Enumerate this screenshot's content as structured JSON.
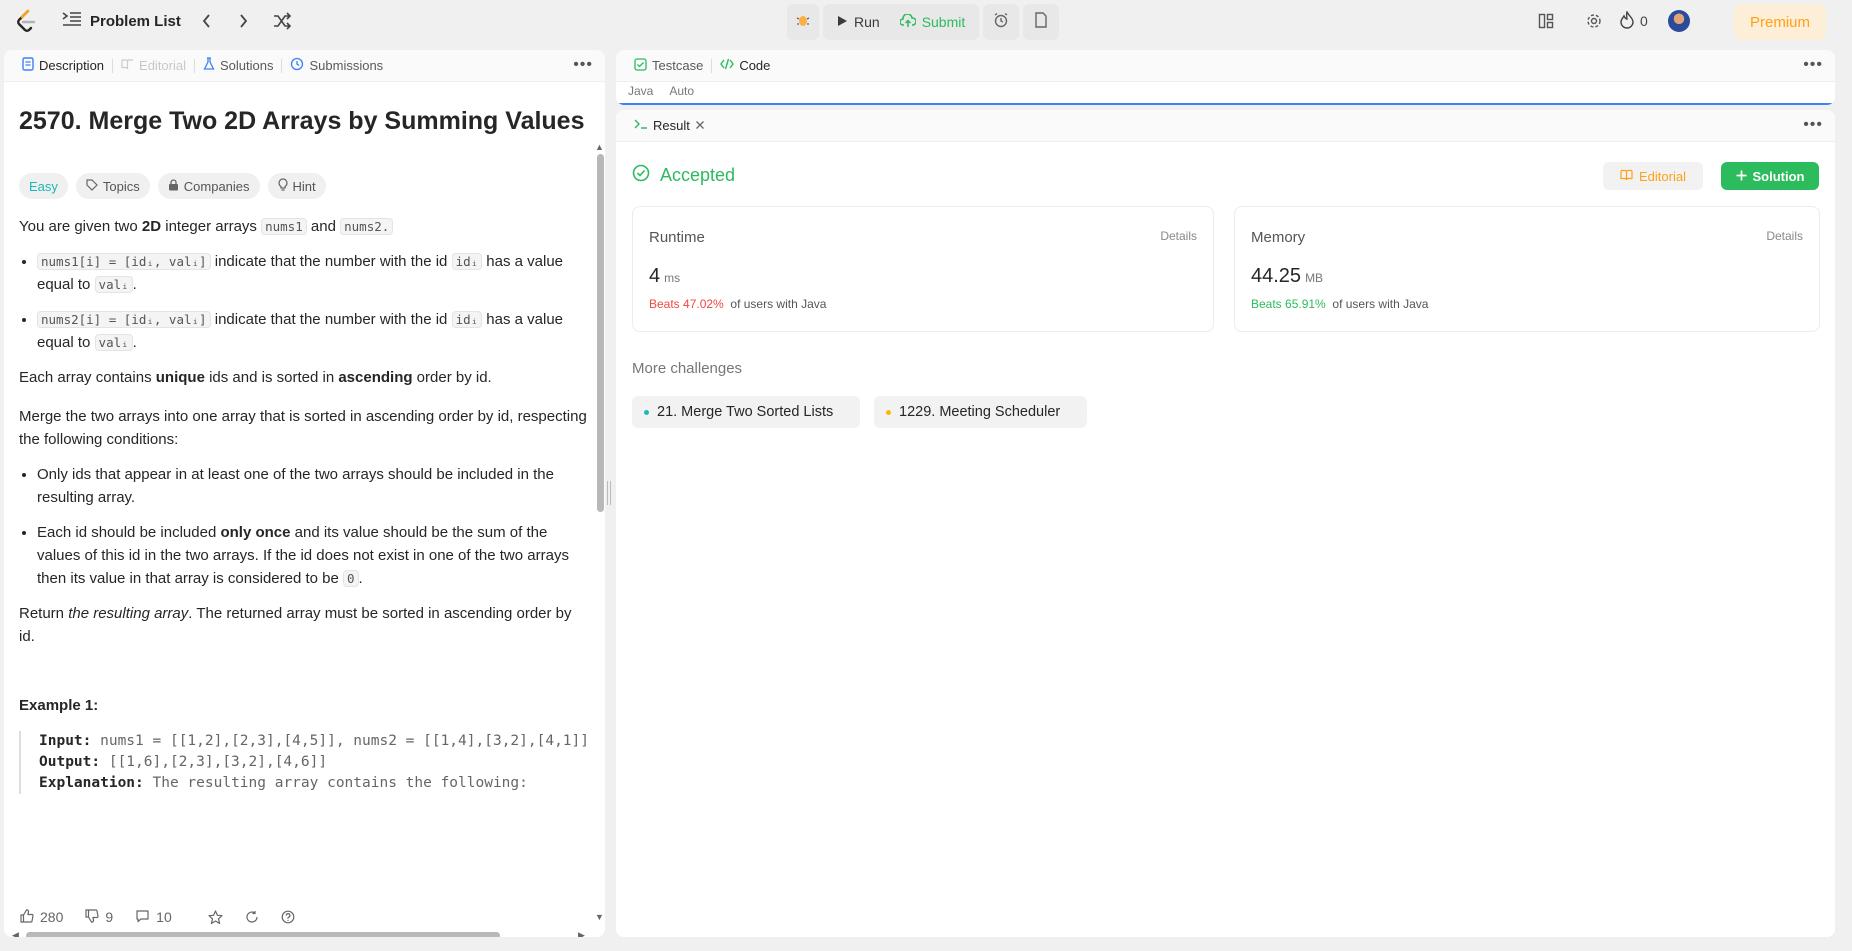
{
  "topbar": {
    "problem_list": "Problem List",
    "run_label": "Run",
    "submit_label": "Submit",
    "streak_count": "0",
    "premium_label": "Premium"
  },
  "left_tabs": {
    "description": "Description",
    "editorial": "Editorial",
    "solutions": "Solutions",
    "submissions": "Submissions"
  },
  "problem": {
    "title": "2570. Merge Two 2D Arrays by Summing Values",
    "difficulty": "Easy",
    "chips": [
      "Topics",
      "Companies",
      "Hint"
    ],
    "intro_pre": "You are given two ",
    "intro_bold": "2D",
    "intro_mid": " integer arrays ",
    "intro_code1": "nums1",
    "intro_and": " and ",
    "intro_code2": "nums2.",
    "bullet1_code": "nums1[i] = [idᵢ, valᵢ]",
    "bullet1_text": " indicate that the number with the id ",
    "bullet1_code2": "idᵢ",
    "bullet1_tail": " has a value equal to ",
    "bullet1_code3": "valᵢ",
    "bullet2_code": "nums2[i] = [idᵢ, valᵢ]",
    "bullet2_text": " indicate that the number with the id ",
    "bullet2_code2": "idᵢ",
    "bullet2_tail": " has a value equal to ",
    "bullet2_code3": "valᵢ",
    "para2_pre": "Each array contains ",
    "para2_bold1": "unique",
    "para2_mid": " ids and is sorted in ",
    "para2_bold2": "ascending",
    "para2_tail": " order by id.",
    "para3": "Merge the two arrays into one array that is sorted in ascending order by id, respecting the following conditions:",
    "cond1": "Only ids that appear in at least one of the two arrays should be included in the resulting array.",
    "cond2_pre": "Each id should be included ",
    "cond2_bold": "only once",
    "cond2_tail": " and its value should be the sum of the values of this id in the two arrays. If the id does not exist in one of the two arrays then its value in that array is considered to be ",
    "cond2_code": "0",
    "para4_pre": "Return ",
    "para4_em": "the resulting array",
    "para4_tail": ". The returned array must be sorted in ascending order by id.",
    "example_title": "Example 1:",
    "ex_input_label": "Input:",
    "ex_input": " nums1 = [[1,2],[2,3],[4,5]], nums2 = [[1,4],[3,2],[4,1]]",
    "ex_output_label": "Output:",
    "ex_output": " [[1,6],[2,3],[3,2],[4,6]]",
    "ex_expl_label": "Explanation:",
    "ex_expl": " The resulting array contains the following:"
  },
  "footer": {
    "likes": "280",
    "dislikes": "9",
    "comments": "10"
  },
  "right_tabs": {
    "testcase": "Testcase",
    "code": "Code",
    "language": "Java",
    "auto": "Auto",
    "result": "Result"
  },
  "result": {
    "status": "Accepted",
    "editorial_btn": "Editorial",
    "solution_btn": "Solution",
    "runtime_label": "Runtime",
    "runtime_details": "Details",
    "runtime_value": "4",
    "runtime_unit": "ms",
    "runtime_beats": "Beats 47.02%",
    "runtime_beats_tail": "of users with Java",
    "memory_label": "Memory",
    "memory_details": "Details",
    "memory_value": "44.25",
    "memory_unit": "MB",
    "memory_beats": "Beats 65.91%",
    "memory_beats_tail": "of users with Java",
    "more_challenges": "More challenges",
    "challenge1": "21. Merge Two Sorted Lists",
    "challenge2": "1229. Meeting Scheduler"
  },
  "colors": {
    "accent_green": "#2cbb5d",
    "premium_orange": "#ffa116",
    "easy_teal": "#1cb8b8",
    "beats_red": "#ef4743"
  }
}
